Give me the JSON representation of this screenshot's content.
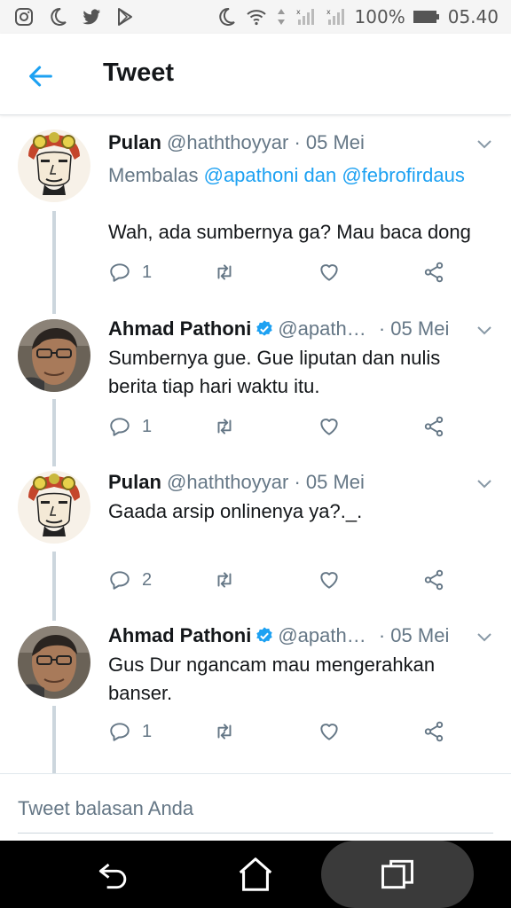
{
  "status_bar": {
    "left_icons": [
      "instagram-icon",
      "moon-icon",
      "twitter-icon",
      "play-store-icon"
    ],
    "battery": "100%",
    "time": "05.40"
  },
  "header": {
    "title": "Tweet"
  },
  "tweets": [
    {
      "name": "Pulan",
      "handle": "@haththoyyar",
      "date": "· 05 Mei",
      "verified": false,
      "reply_prefix": "Membalas",
      "reply_mention_1": "@apathoni",
      "reply_and": "dan",
      "reply_mention_2": "@febrofirdaus",
      "text": "Wah, ada sumbernya ga? Mau baca dong",
      "reply_count": "1"
    },
    {
      "name": "Ahmad Pathoni",
      "handle": "@apath…",
      "date": "· 05 Mei",
      "verified": true,
      "text": "Sumbernya gue. Gue liputan dan nulis berita tiap hari waktu itu.",
      "reply_count": "1"
    },
    {
      "name": "Pulan",
      "handle": "@haththoyyar",
      "date": "· 05 Mei",
      "verified": false,
      "text": "Gaada arsip onlinenya ya?._.",
      "reply_count": "2"
    },
    {
      "name": "Ahmad Pathoni",
      "handle": "@apath…",
      "date": "· 05 Mei",
      "verified": true,
      "text": "Gus Dur ngancam mau mengerahkan banser.",
      "reply_count": "1"
    }
  ],
  "reply_box": {
    "placeholder": "Tweet balasan Anda"
  },
  "colors": {
    "accent": "#1da1f2",
    "secondary_text": "#657786",
    "thread_line": "#ccd6dd"
  }
}
